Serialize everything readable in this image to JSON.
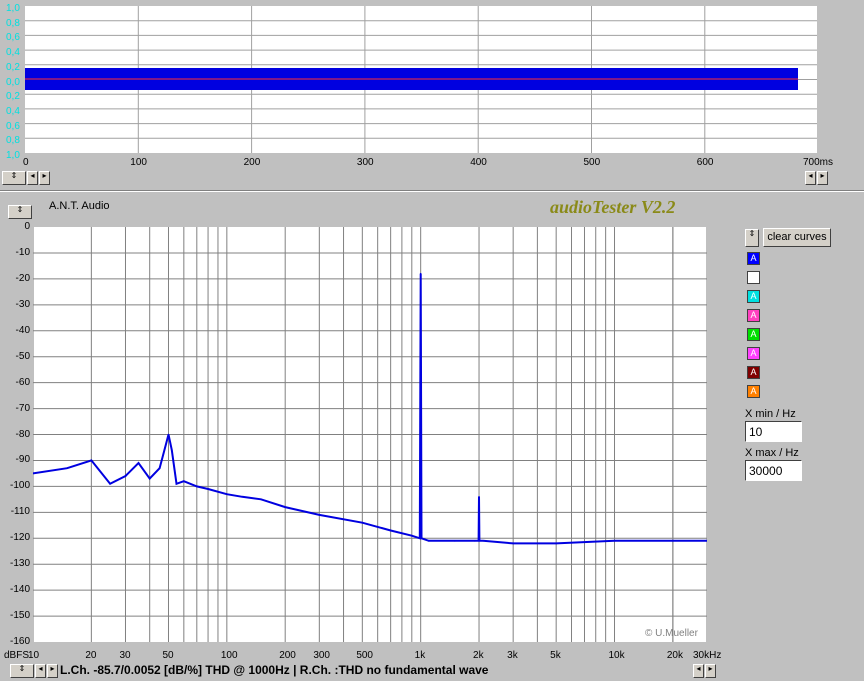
{
  "top_panel": {
    "y_ticks": [
      "1,0",
      "0,8",
      "0,6",
      "0,4",
      "0,2",
      "0,0",
      "0,2",
      "0,4",
      "0,6",
      "0,8",
      "1,0"
    ],
    "x_ticks": [
      "0",
      "100",
      "200",
      "300",
      "400",
      "500",
      "600"
    ],
    "x_last": "700ms"
  },
  "header": {
    "device": "A.N.T. Audio",
    "app_title": "audioTester V2.2"
  },
  "spectrum": {
    "y_ticks": [
      "0",
      "-10",
      "-20",
      "-30",
      "-40",
      "-50",
      "-60",
      "-70",
      "-80",
      "-90",
      "-100",
      "-110",
      "-120",
      "-130",
      "-140",
      "-150",
      "-160"
    ],
    "y_unit": "dBFS",
    "x_ticks": [
      "10",
      "20",
      "30",
      "50",
      "100",
      "200",
      "300",
      "500",
      "1k",
      "2k",
      "3k",
      "5k",
      "10k",
      "20k",
      "30kHz"
    ],
    "copyright": "© U.Mueller",
    "trace_color": "#0000e0"
  },
  "right_panel": {
    "clear_label": "clear curves",
    "swatches": [
      {
        "label": "A",
        "color": "#0000ff",
        "text": "#ffffff"
      },
      {
        "label": "",
        "color": "#ffffff",
        "text": "#000000"
      },
      {
        "label": "A",
        "color": "#00e0e0",
        "text": "#ffffff"
      },
      {
        "label": "A",
        "color": "#ff40c0",
        "text": "#ffffff"
      },
      {
        "label": "A",
        "color": "#00e000",
        "text": "#ffffff"
      },
      {
        "label": "A",
        "color": "#ff40ff",
        "text": "#ffffff"
      },
      {
        "label": "A",
        "color": "#800000",
        "text": "#ffffff"
      },
      {
        "label": "A",
        "color": "#ff8000",
        "text": "#ffffff"
      }
    ],
    "xmin_label": "X min / Hz",
    "xmin_value": "10",
    "xmax_label": "X max / Hz",
    "xmax_value": "30000"
  },
  "status": {
    "text": "L.Ch. -85.7/0.0052 [dB/%] THD @ 1000Hz   | R.Ch. :THD no fundamental wave"
  },
  "chart_data": {
    "type": "line",
    "title": "",
    "xlabel": "",
    "ylabel": "dBFS",
    "x_scale": "log",
    "xlim": [
      10,
      30000
    ],
    "ylim": [
      -160,
      0
    ],
    "grid": true,
    "series": [
      {
        "x": [
          10,
          15,
          20,
          25,
          30,
          35,
          40,
          45,
          48,
          50,
          52,
          55,
          60,
          70,
          80,
          100,
          120,
          150,
          200,
          300,
          500,
          700,
          900,
          990,
          1000,
          1010,
          1100,
          1500,
          1900,
          1990,
          2000,
          2010,
          2100,
          3000,
          5000,
          10000,
          20000,
          30000
        ],
        "y": [
          -95,
          -93,
          -90,
          -99,
          -96,
          -91,
          -97,
          -93,
          -85,
          -80,
          -86,
          -99,
          -98,
          -100,
          -101,
          -103,
          -104,
          -105,
          -108,
          -111,
          -114,
          -117,
          -119,
          -120,
          -18,
          -120,
          -121,
          -121,
          -121,
          -121,
          -104,
          -121,
          -121,
          -122,
          -122,
          -121,
          -121,
          -121
        ]
      }
    ]
  }
}
